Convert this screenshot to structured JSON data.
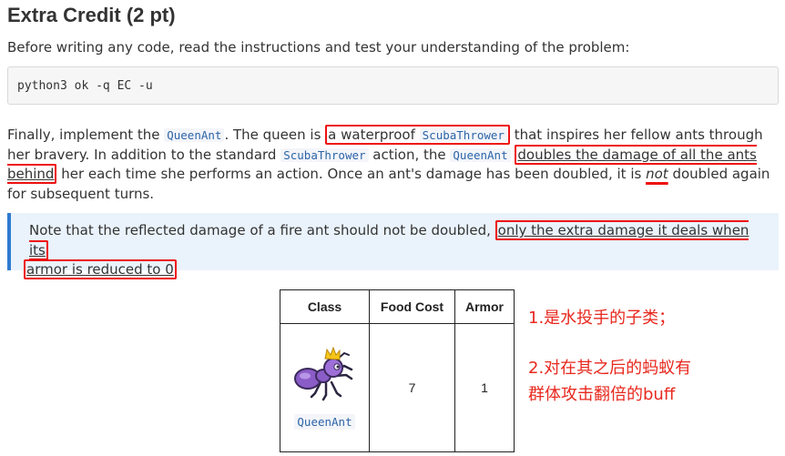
{
  "title": "Extra Credit (2 pt)",
  "intro": "Before writing any code, read the instructions and test your understanding of the problem:",
  "command": "python3 ok -q EC -u",
  "para": {
    "t1": "Finally, implement the ",
    "code1": "QueenAnt",
    "t2": ". The queen is ",
    "box1_text": "a waterproof ",
    "box1_code": "ScubaThrower",
    "t3": " that inspires her fellow ants through her bravery. In addition to the standard ",
    "code2": "ScubaThrower",
    "t4": " action, the ",
    "code3": "QueenAnt",
    "t5": " ",
    "box2_text": "doubles the damage of all the ants behind",
    "t6": " her each time she performs an action. Once an ant's damage has been doubled, it is ",
    "emph": "not",
    "t7": " doubled again for subsequent turns."
  },
  "note": {
    "t1": "Note that the reflected damage of a fire ant should not be doubled, ",
    "box_line1": "only the extra damage it deals when its",
    "box_line2": "armor is reduced to 0"
  },
  "table": {
    "headers": [
      "Class",
      "Food Cost",
      "Armor"
    ],
    "row": {
      "name": "QueenAnt",
      "food_cost": "7",
      "armor": "1"
    }
  },
  "annotations": {
    "a1": "1.是水投手的子类；",
    "a2_line1": "2.对在其之后的蚂蚁有",
    "a2_line2": "群体攻击翻倍的buff"
  },
  "colors": {
    "annotation": "#e8281e",
    "code": "#2d64a8",
    "note_bg": "#eaf3fc",
    "note_border": "#2e7bcf"
  },
  "icons": {
    "queen_ant": "queen-ant-icon"
  }
}
